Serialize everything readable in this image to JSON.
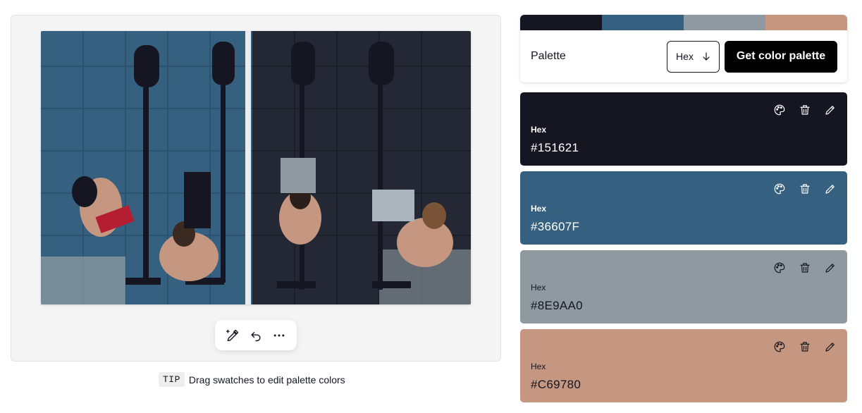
{
  "colors": {
    "c1": "#151621",
    "c2": "#36607F",
    "c3": "#8E9AA0",
    "c4": "#C69780"
  },
  "image_toolbar": {
    "icons": [
      "eyedropper-plus-icon",
      "undo-icon",
      "more-icon"
    ]
  },
  "tip": {
    "badge": "TIP",
    "text": "Drag swatches to edit palette colors"
  },
  "palette": {
    "label": "Palette",
    "format_value": "Hex",
    "button_label": "Get color palette"
  },
  "swatches": [
    {
      "format": "Hex",
      "value": "#151621"
    },
    {
      "format": "Hex",
      "value": "#36607F"
    },
    {
      "format": "Hex",
      "value": "#8E9AA0"
    },
    {
      "format": "Hex",
      "value": "#C69780"
    }
  ],
  "swatch_action_icons": [
    "palette-icon",
    "trash-icon",
    "pencil-icon"
  ]
}
